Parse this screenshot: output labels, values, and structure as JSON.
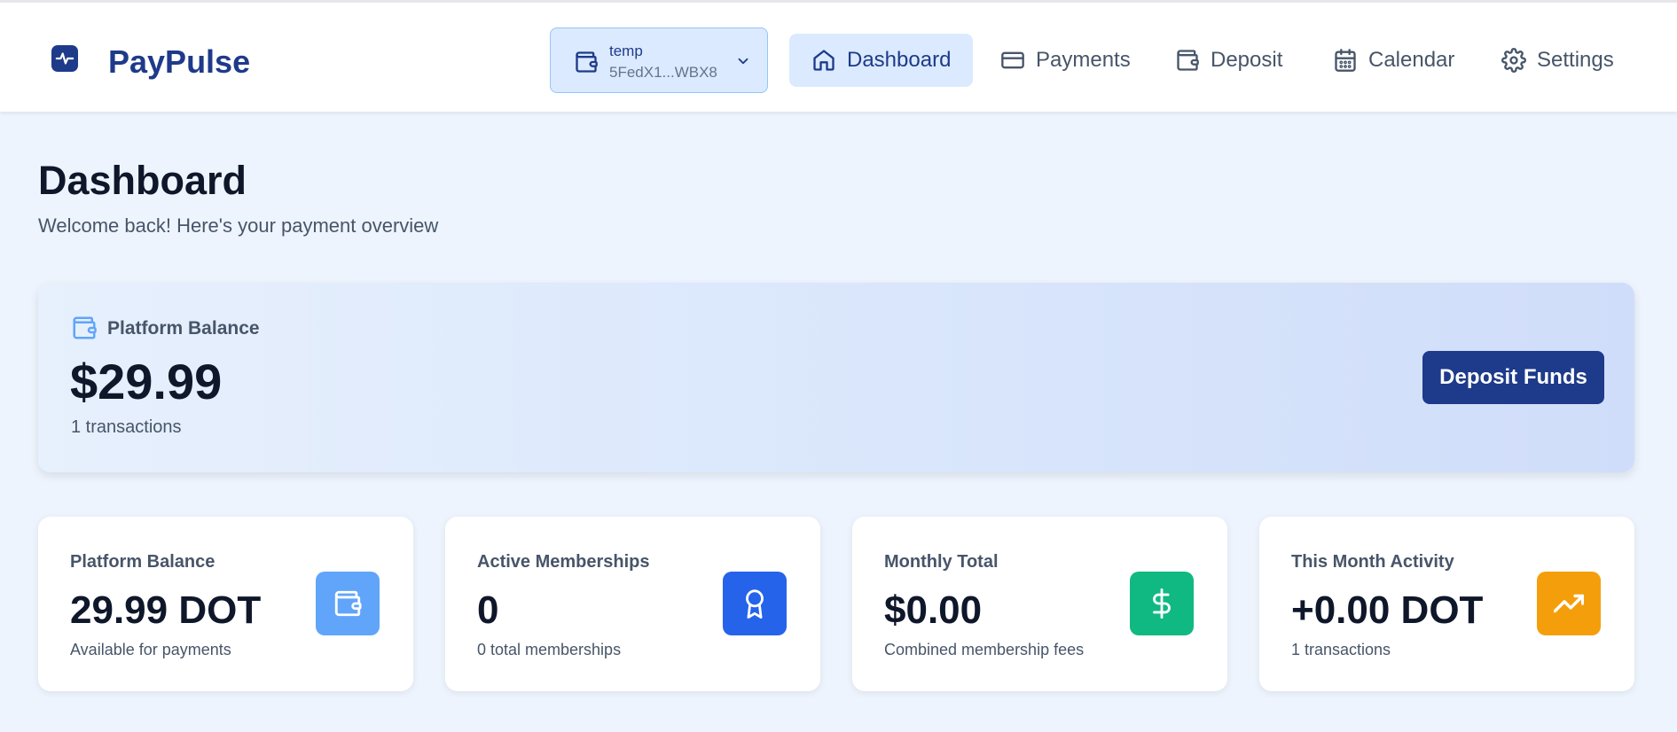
{
  "app": {
    "name": "PayPulse",
    "brand_color": "#1e3a8a"
  },
  "wallet": {
    "name": "temp",
    "address": "5FedX1...WBX8",
    "icon": "wallet-icon"
  },
  "nav": [
    {
      "label": "Dashboard",
      "icon": "home-icon",
      "active": true
    },
    {
      "label": "Payments",
      "icon": "credit-card-icon",
      "active": false
    },
    {
      "label": "Deposit",
      "icon": "wallet-icon",
      "active": false
    },
    {
      "label": "Calendar",
      "icon": "calendar-icon",
      "active": false
    },
    {
      "label": "Settings",
      "icon": "gear-icon",
      "active": false
    }
  ],
  "page": {
    "title": "Dashboard",
    "subtitle": "Welcome back! Here's your payment overview"
  },
  "balance_card": {
    "label": "Platform Balance",
    "amount": "$29.99",
    "subtext": "1 transactions",
    "button_label": "Deposit Funds"
  },
  "stats": [
    {
      "label": "Platform Balance",
      "value": "29.99 DOT",
      "subtext": "Available for payments",
      "icon": "wallet-icon",
      "color": "#60a5fa"
    },
    {
      "label": "Active Memberships",
      "value": "0",
      "subtext": "0 total memberships",
      "icon": "award-icon",
      "color": "#2563eb"
    },
    {
      "label": "Monthly Total",
      "value": "$0.00",
      "subtext": "Combined membership fees",
      "icon": "dollar-icon",
      "color": "#10b981"
    },
    {
      "label": "This Month Activity",
      "value": "+0.00 DOT",
      "subtext": "1 transactions",
      "icon": "trending-up-icon",
      "color": "#f59e0b"
    }
  ]
}
